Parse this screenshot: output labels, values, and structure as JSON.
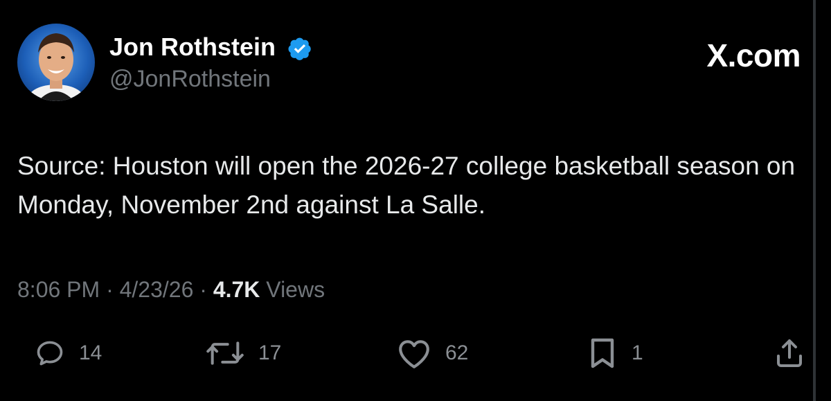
{
  "author": {
    "name": "Jon Rothstein",
    "handle": "@JonRothstein",
    "verified": true
  },
  "brand": "X.com",
  "tweet": {
    "text": "Source: Houston will open the 2026-27 college basketball season on Monday, November 2nd against La Salle."
  },
  "meta": {
    "time": "8:06 PM",
    "separator": " · ",
    "date": "4/23/26",
    "views_count": "4.7K",
    "views_label": " Views"
  },
  "actions": {
    "replies": "14",
    "reposts": "17",
    "likes": "62",
    "bookmarks": "1"
  },
  "colors": {
    "background": "#000000",
    "text": "#e7e9ea",
    "secondary": "#71767b",
    "verified": "#1d9bf0"
  }
}
